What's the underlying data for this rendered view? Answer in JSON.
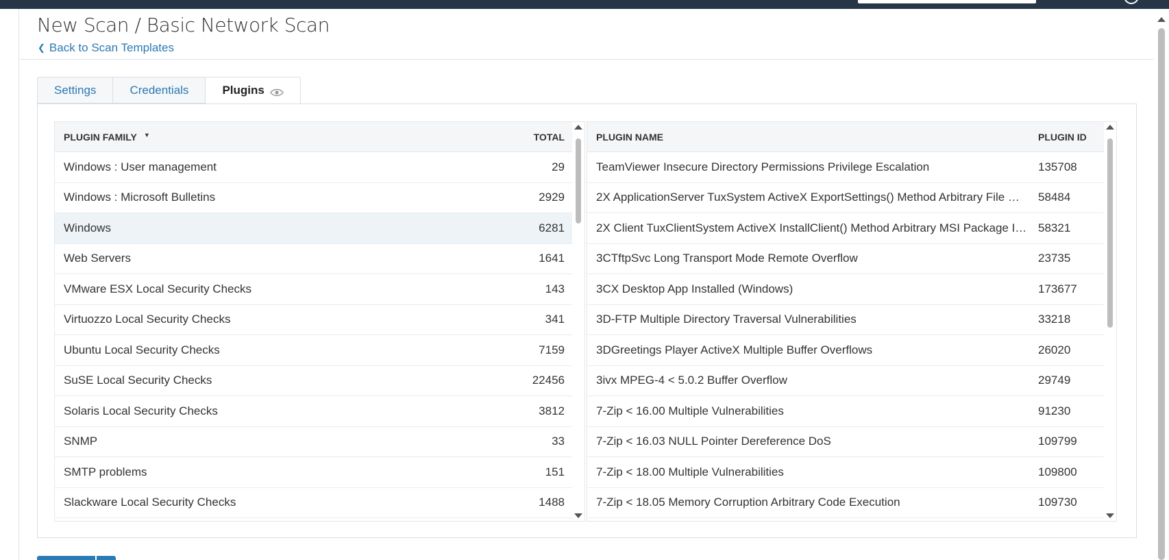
{
  "header": {
    "title": "New Scan / Basic Network Scan",
    "back_label": "Back to Scan Templates"
  },
  "tabs": [
    {
      "label": "Settings",
      "active": false
    },
    {
      "label": "Credentials",
      "active": false
    },
    {
      "label": "Plugins",
      "active": true
    }
  ],
  "families_table": {
    "columns": [
      "PLUGIN FAMILY",
      "TOTAL"
    ],
    "sort": "descending",
    "rows": [
      {
        "family": "Windows : User management",
        "total": "29"
      },
      {
        "family": "Windows : Microsoft Bulletins",
        "total": "2929"
      },
      {
        "family": "Windows",
        "total": "6281"
      },
      {
        "family": "Web Servers",
        "total": "1641"
      },
      {
        "family": "VMware ESX Local Security Checks",
        "total": "143"
      },
      {
        "family": "Virtuozzo Local Security Checks",
        "total": "341"
      },
      {
        "family": "Ubuntu Local Security Checks",
        "total": "7159"
      },
      {
        "family": "SuSE Local Security Checks",
        "total": "22456"
      },
      {
        "family": "Solaris Local Security Checks",
        "total": "3812"
      },
      {
        "family": "SNMP",
        "total": "33"
      },
      {
        "family": "SMTP problems",
        "total": "151"
      },
      {
        "family": "Slackware Local Security Checks",
        "total": "1488"
      }
    ]
  },
  "plugins_table": {
    "columns": [
      "PLUGIN NAME",
      "PLUGIN ID"
    ],
    "rows": [
      {
        "name": "TeamViewer Insecure Directory Permissions Privilege Escalation",
        "id": "135708"
      },
      {
        "name": "2X ApplicationServer TuxSystem ActiveX ExportSettings() Method Arbitrary File Ov...",
        "id": "58484"
      },
      {
        "name": "2X Client TuxClientSystem ActiveX InstallClient() Method Arbitrary MSI Package Ins...",
        "id": "58321"
      },
      {
        "name": "3CTftpSvc Long Transport Mode Remote Overflow",
        "id": "23735"
      },
      {
        "name": "3CX Desktop App Installed (Windows)",
        "id": "173677"
      },
      {
        "name": "3D-FTP Multiple Directory Traversal Vulnerabilities",
        "id": "33218"
      },
      {
        "name": "3DGreetings Player ActiveX Multiple Buffer Overflows",
        "id": "26020"
      },
      {
        "name": "3ivx MPEG-4 < 5.0.2 Buffer Overflow",
        "id": "29749"
      },
      {
        "name": "7-Zip < 16.00 Multiple Vulnerabilities",
        "id": "91230"
      },
      {
        "name": "7-Zip < 16.03 NULL Pointer Dereference DoS",
        "id": "109799"
      },
      {
        "name": "7-Zip < 18.00 Multiple Vulnerabilities",
        "id": "109800"
      },
      {
        "name": "7-Zip < 18.05 Memory Corruption Arbitrary Code Execution",
        "id": "109730"
      }
    ]
  },
  "colors": {
    "topbar": "#263647",
    "link": "#2a7ab3",
    "row_highlight": "#eef3f7"
  }
}
